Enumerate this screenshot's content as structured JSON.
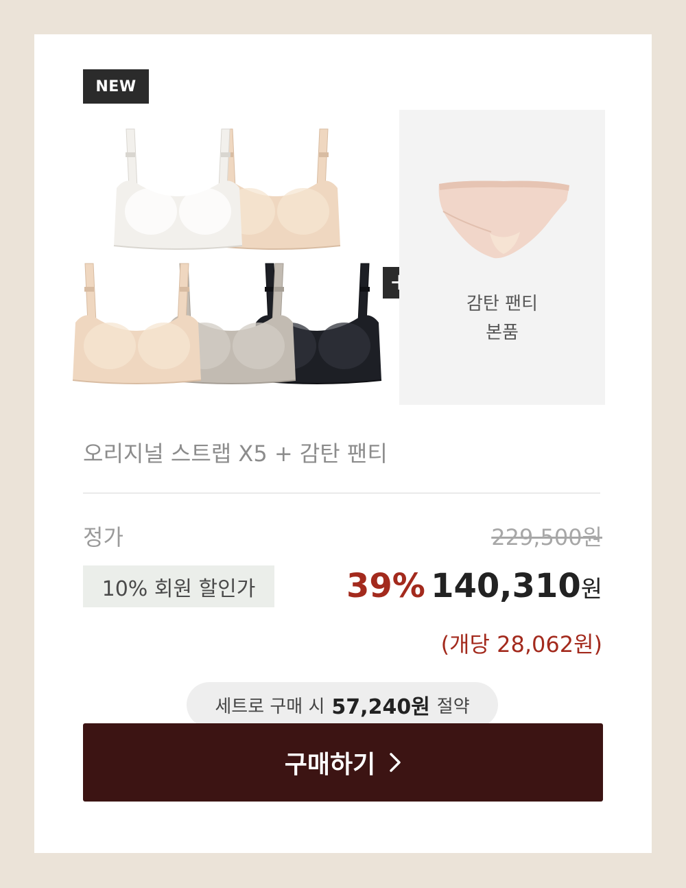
{
  "badge": {
    "new": "NEW"
  },
  "bundle": {
    "plus_symbol": "+"
  },
  "gift": {
    "name": "감탄 팬티",
    "note": "본품"
  },
  "product": {
    "title": "오리지널 스트랩 X5 + 감탄 팬티"
  },
  "pricing": {
    "regular_label": "정가",
    "regular_price": "229,500원",
    "member_label": "10% 회원 할인가",
    "discount_rate": "39%",
    "final_price": "140,310",
    "final_unit": "원",
    "per_unit": "(개당 28,062원)"
  },
  "savings": {
    "prefix": "세트로 구매 시",
    "amount": "57,240원",
    "suffix": "절약"
  },
  "buy": {
    "label": "구매하기"
  },
  "colors": {
    "background": "#ebe3d8",
    "button": "#3c1413",
    "discount_red": "#a32a1d",
    "bra_ivory": "#f2f0ec",
    "bra_beige": "#efd7c0",
    "bra_gray": "#c2bbb2",
    "bra_black": "#1d1f25",
    "panty_pink": "#f1d6c9"
  },
  "icons": {
    "plus": "plus-icon",
    "chevron": "chevron-right-icon"
  }
}
